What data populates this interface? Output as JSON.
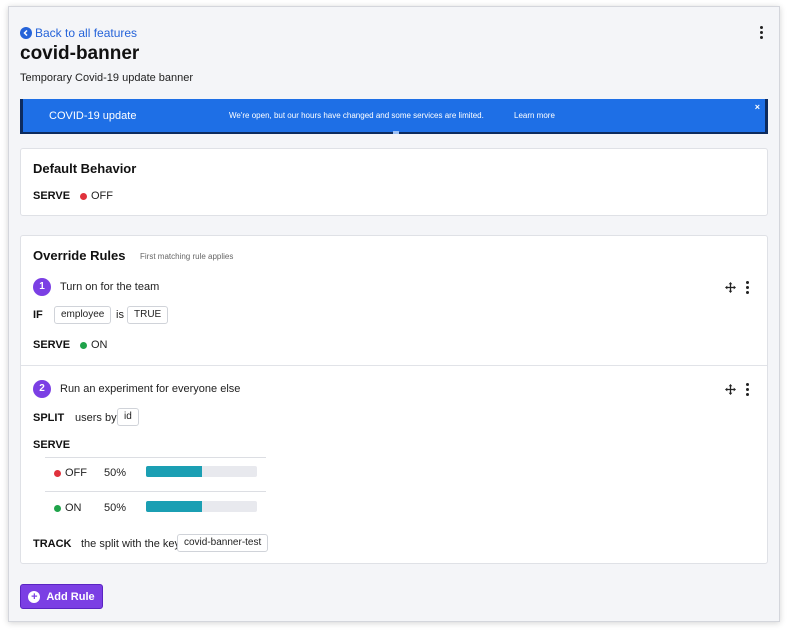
{
  "header": {
    "back_label": "Back to all features",
    "title": "covid-banner",
    "description": "Temporary Covid-19 update banner"
  },
  "banner": {
    "title": "COVID-19 update",
    "message": "We're open, but our hours have changed and some services are limited.",
    "link": "Learn more",
    "close": "×",
    "color": "#1e6fe6"
  },
  "default_behavior": {
    "heading": "Default Behavior",
    "serve_label": "SERVE",
    "serve_value": "OFF",
    "serve_color": "#e0323c"
  },
  "override_rules": {
    "heading": "Override Rules",
    "subtitle": "First matching rule applies",
    "rules": [
      {
        "number": "1",
        "name": "Turn on for the team",
        "condition_label": "IF",
        "attribute": "employee",
        "operator": "is",
        "value": "TRUE",
        "serve_label": "SERVE",
        "serve_value": "ON"
      },
      {
        "number": "2",
        "name": "Run an experiment for everyone else",
        "split_label": "SPLIT",
        "split_text": "users by",
        "split_attribute": "id",
        "serve_label": "SERVE",
        "variations": [
          {
            "name": "OFF",
            "percent": "50%",
            "fraction": 0.5,
            "color": "#e0323c"
          },
          {
            "name": "ON",
            "percent": "50%",
            "fraction": 0.5,
            "color": "#1fa34a"
          }
        ],
        "track_label": "TRACK",
        "track_text": "the split with the key",
        "track_key": "covid-banner-test"
      }
    ]
  },
  "actions": {
    "add_rule": "Add Rule",
    "accent": "#7b3fe4"
  }
}
